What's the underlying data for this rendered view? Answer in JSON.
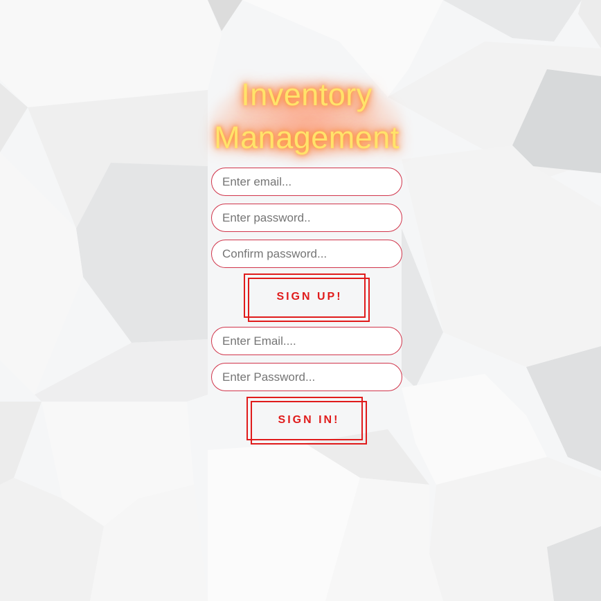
{
  "app": {
    "title_line1": "Inventory",
    "title_line2": "Management"
  },
  "signup": {
    "email_placeholder": "Enter email...",
    "password_placeholder": "Enter password..",
    "confirm_placeholder": "Confirm password...",
    "button_label": "SIGN UP!"
  },
  "signin": {
    "email_placeholder": "Enter Email....",
    "password_placeholder": "Enter Password...",
    "button_label": "SIGN IN!"
  },
  "colors": {
    "accent": "#e01b1b",
    "field_border": "#d0344a",
    "title": "#ffe36a",
    "title_glow": "#ff7a2f"
  }
}
